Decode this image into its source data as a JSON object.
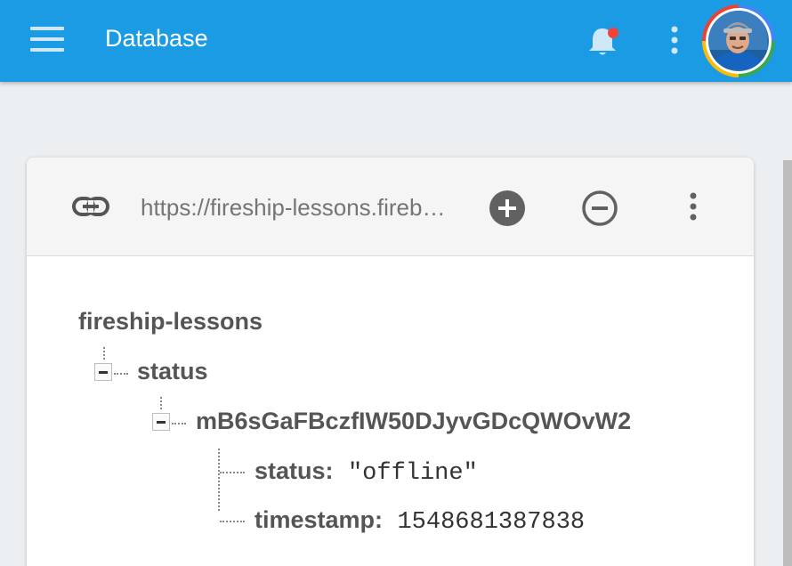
{
  "appbar": {
    "title": "Database",
    "menu_icon": "hamburger-icon",
    "notification_icon": "bell-icon",
    "more_icon": "more-vert-icon",
    "color": "#1a9be4"
  },
  "toolbar": {
    "url": "https://fireship-lessons.firebaseio.com/",
    "link_icon": "link-icon",
    "add_icon": "add-circle-icon",
    "remove_icon": "remove-circle-icon",
    "more_icon": "more-vert-icon"
  },
  "tree": {
    "root": "fireship-lessons",
    "child": "status",
    "grandchild": "mB6sGaFBczfIW50DJyvGDcQWOvW2",
    "fields": [
      {
        "key": "status:",
        "value": "\"offline\""
      },
      {
        "key": "timestamp:",
        "value": "1548681387838"
      }
    ]
  }
}
